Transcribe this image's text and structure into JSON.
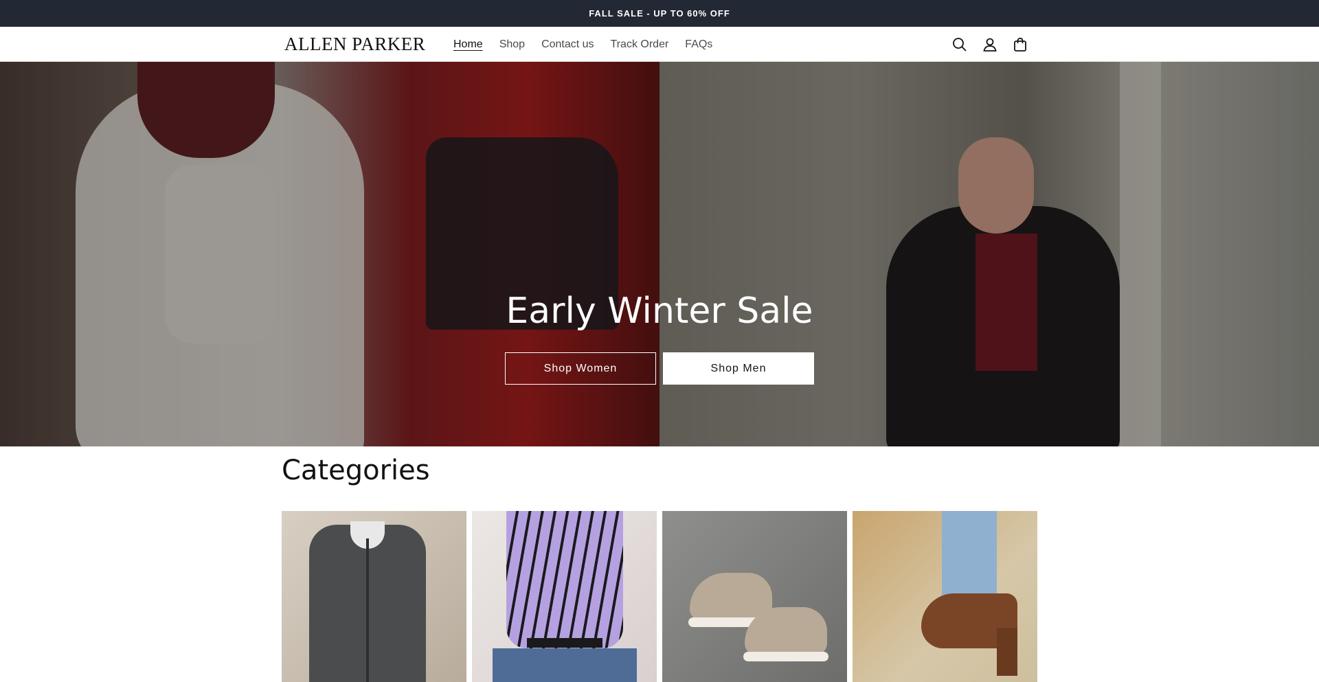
{
  "announcement": {
    "text": "FALL SALE - UP TO 60% OFF"
  },
  "header": {
    "logo": "ALLEN PARKER",
    "nav": [
      {
        "label": "Home",
        "active": true
      },
      {
        "label": "Shop",
        "active": false
      },
      {
        "label": "Contact us",
        "active": false
      },
      {
        "label": "Track Order",
        "active": false
      },
      {
        "label": "FAQs",
        "active": false
      }
    ],
    "icons": [
      "search-icon",
      "account-icon",
      "cart-icon"
    ]
  },
  "hero": {
    "title": "Early Winter Sale",
    "buttons": {
      "women": "Shop Women",
      "men": "Shop Men"
    }
  },
  "categories": {
    "title": "Categories"
  },
  "colors": {
    "announcement_bg": "#232835",
    "text": "#121212"
  }
}
